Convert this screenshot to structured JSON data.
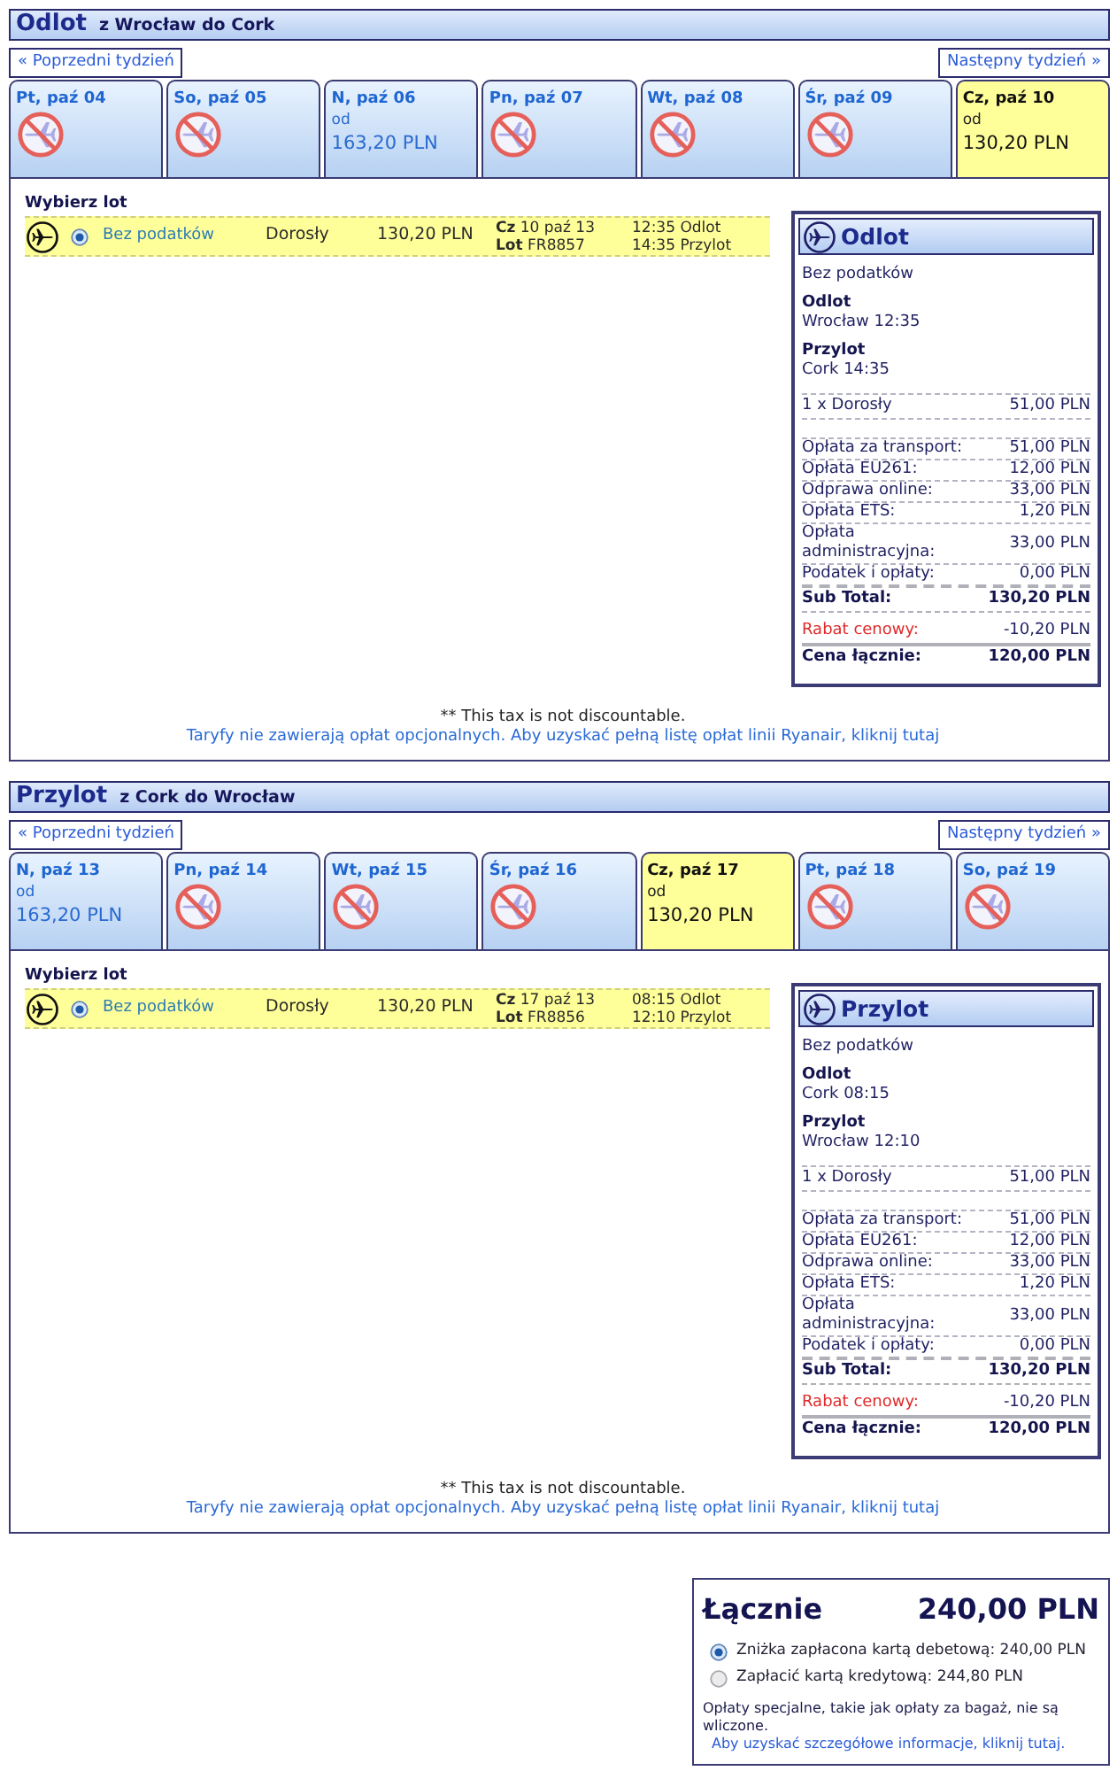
{
  "sections": [
    {
      "title": "Odlot",
      "route": "z Wrocław do Cork",
      "prev_week": "« Poprzedni tydzień",
      "next_week": "Następny tydzień »",
      "days": [
        {
          "label": "Pt, paź 04",
          "kind": "none",
          "selected": false
        },
        {
          "label": "So, paź 05",
          "kind": "none",
          "selected": false
        },
        {
          "label": "N, paź 06",
          "kind": "fare",
          "from": "od",
          "price": "163,20 PLN",
          "selected": false
        },
        {
          "label": "Pn, paź 07",
          "kind": "none",
          "selected": false
        },
        {
          "label": "Wt, paź 08",
          "kind": "none",
          "selected": false
        },
        {
          "label": "Śr, paź 09",
          "kind": "none",
          "selected": false
        },
        {
          "label": "Cz, paź 10",
          "kind": "fare",
          "from": "od",
          "price": "130,20 PLN",
          "selected": true
        }
      ],
      "choose_label": "Wybierz lot",
      "flights": [
        {
          "selected": true,
          "fare": "Bez podatków",
          "passenger": "Dorosły",
          "price": "130,20 PLN",
          "date": "**Cz** 10 paź 13",
          "flight_number": "**Lot** FR8857",
          "departure": "12:35 Odlot",
          "arrival": "14:35 Przylot"
        }
      ],
      "summary": {
        "title": "Odlot",
        "fare": "Bez podatków",
        "legs": [
          {
            "label": "Odlot",
            "value": "Wrocław 12:35"
          },
          {
            "label": "Przylot",
            "value": "Cork 14:35"
          }
        ],
        "passengers": [
          {
            "label": "1 x Dorosły",
            "value": "51,00 PLN"
          }
        ],
        "fees": [
          {
            "label": "Opłata za transport:",
            "value": "51,00 PLN"
          },
          {
            "label": "Opłata EU261:",
            "value": "12,00 PLN"
          },
          {
            "label": "Odprawa online:",
            "value": "33,00 PLN"
          },
          {
            "label": "Opłata ETS:",
            "value": "1,20 PLN"
          },
          {
            "label": "Opłata administracyjna:",
            "value": "33,00 PLN"
          },
          {
            "label": "Podatek i opłaty:",
            "value": "0,00 PLN"
          }
        ],
        "subtotal": {
          "label": "Sub Total:",
          "value": "130,20 PLN"
        },
        "discount": {
          "label": "Rabat cenowy:",
          "value": "-10,20 PLN"
        },
        "total": {
          "label": "Cena łącznie:",
          "value": "120,00 PLN"
        }
      },
      "footnote": "** This tax is not discountable.",
      "fees_link": "Taryfy nie zawierają opłat opcjonalnych. Aby uzyskać pełną listę opłat linii Ryanair, kliknij tutaj"
    },
    {
      "title": "Przylot",
      "route": "z Cork do Wrocław",
      "prev_week": "« Poprzedni tydzień",
      "next_week": "Następny tydzień »",
      "days": [
        {
          "label": "N, paź 13",
          "kind": "fare",
          "from": "od",
          "price": "163,20 PLN",
          "selected": false
        },
        {
          "label": "Pn, paź 14",
          "kind": "none",
          "selected": false
        },
        {
          "label": "Wt, paź 15",
          "kind": "none",
          "selected": false
        },
        {
          "label": "Śr, paź 16",
          "kind": "none",
          "selected": false
        },
        {
          "label": "Cz, paź 17",
          "kind": "fare",
          "from": "od",
          "price": "130,20 PLN",
          "selected": true
        },
        {
          "label": "Pt, paź 18",
          "kind": "none",
          "selected": false
        },
        {
          "label": "So, paź 19",
          "kind": "none",
          "selected": false
        }
      ],
      "choose_label": "Wybierz lot",
      "flights": [
        {
          "selected": true,
          "fare": "Bez podatków",
          "passenger": "Dorosły",
          "price": "130,20 PLN",
          "date": "**Cz** 17 paź 13",
          "flight_number": "**Lot** FR8856",
          "departure": "08:15 Odlot",
          "arrival": "12:10 Przylot"
        }
      ],
      "summary": {
        "title": "Przylot",
        "fare": "Bez podatków",
        "legs": [
          {
            "label": "Odlot",
            "value": "Cork 08:15"
          },
          {
            "label": "Przylot",
            "value": "Wrocław 12:10"
          }
        ],
        "passengers": [
          {
            "label": "1 x Dorosły",
            "value": "51,00 PLN"
          }
        ],
        "fees": [
          {
            "label": "Opłata za transport:",
            "value": "51,00 PLN"
          },
          {
            "label": "Opłata EU261:",
            "value": "12,00 PLN"
          },
          {
            "label": "Odprawa online:",
            "value": "33,00 PLN"
          },
          {
            "label": "Opłata ETS:",
            "value": "1,20 PLN"
          },
          {
            "label": "Opłata administracyjna:",
            "value": "33,00 PLN"
          },
          {
            "label": "Podatek i opłaty:",
            "value": "0,00 PLN"
          }
        ],
        "subtotal": {
          "label": "Sub Total:",
          "value": "130,20 PLN"
        },
        "discount": {
          "label": "Rabat cenowy:",
          "value": "-10,20 PLN"
        },
        "total": {
          "label": "Cena łącznie:",
          "value": "120,00 PLN"
        }
      },
      "footnote": "** This tax is not discountable.",
      "fees_link": "Taryfy nie zawierają opłat opcjonalnych. Aby uzyskać pełną listę opłat linii Ryanair, kliknij tutaj"
    }
  ],
  "total": {
    "label": "Łącznie",
    "amount": "240,00 PLN",
    "payment_options": [
      {
        "label": "Zniżka zapłacona kartą debetową: 240,00 PLN",
        "selected": true
      },
      {
        "label": "Zapłacić kartą kredytową: 244,80 PLN",
        "selected": false
      }
    ],
    "note": "Opłaty specjalne, takie jak opłaty za bagaż, nie są wliczone.",
    "details_link": "Aby uzyskać szczegółowe informacje, kliknij tutaj."
  }
}
